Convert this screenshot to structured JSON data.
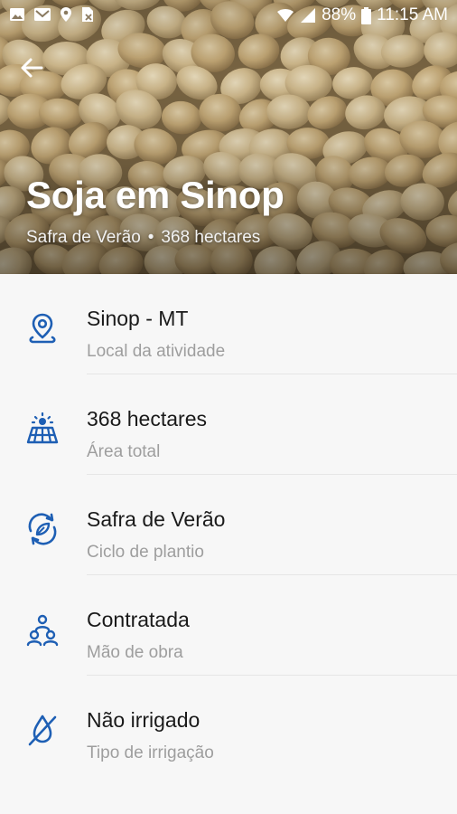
{
  "status_bar": {
    "battery_percent": "88%",
    "time": "11:15 AM",
    "left_icons": [
      "image-icon",
      "mail-icon",
      "location-icon",
      "no-sim-icon"
    ],
    "right_icons": [
      "wifi-icon",
      "signal-icon",
      "battery-icon"
    ]
  },
  "header": {
    "title": "Soja em Sinop",
    "season": "Safra de Verão",
    "separator": "•",
    "area": "368 hectares",
    "back_icon": "arrow-back-icon"
  },
  "details": [
    {
      "icon": "location-pin-icon",
      "value": "Sinop - MT",
      "label": "Local da atividade"
    },
    {
      "icon": "field-area-icon",
      "value": "368 hectares",
      "label": "Área total"
    },
    {
      "icon": "cycle-leaf-icon",
      "value": "Safra de Verão",
      "label": "Ciclo de plantio"
    },
    {
      "icon": "people-icon",
      "value": "Contratada",
      "label": "Mão de obra"
    },
    {
      "icon": "no-irrigation-icon",
      "value": "Não irrigado",
      "label": "Tipo de irrigação"
    }
  ],
  "colors": {
    "accent": "#1e5fb4",
    "primary_text": "#1a1a1a",
    "secondary_text": "#9e9e9e"
  }
}
